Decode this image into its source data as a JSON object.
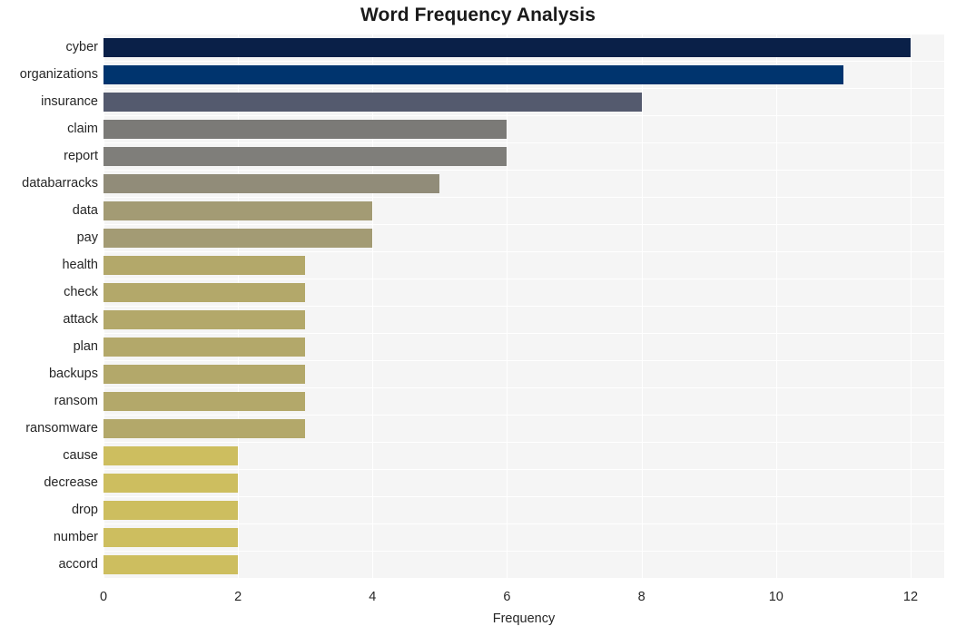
{
  "chart_data": {
    "type": "bar",
    "orientation": "horizontal",
    "title": "Word Frequency Analysis",
    "xlabel": "Frequency",
    "ylabel": "",
    "categories": [
      "cyber",
      "organizations",
      "insurance",
      "claim",
      "report",
      "databarracks",
      "data",
      "pay",
      "health",
      "check",
      "attack",
      "plan",
      "backups",
      "ransom",
      "ransomware",
      "cause",
      "decrease",
      "drop",
      "number",
      "accord"
    ],
    "values": [
      12,
      11,
      8,
      6,
      6,
      5,
      4,
      4,
      3,
      3,
      3,
      3,
      3,
      3,
      3,
      2,
      2,
      2,
      2,
      2
    ],
    "bar_colors": [
      "#0a2048",
      "#00346e",
      "#545a6e",
      "#7b7a77",
      "#7f7e7a",
      "#918c79",
      "#a39b74",
      "#a39b74",
      "#b3a86a",
      "#b3a86a",
      "#b3a86a",
      "#b3a86a",
      "#b3a86a",
      "#b3a86a",
      "#b3a86a",
      "#cdbe5f",
      "#cdbe5f",
      "#cdbe5f",
      "#cdbe5f",
      "#cdbe5f"
    ],
    "xlim": [
      0,
      12.5
    ],
    "xticks": [
      0,
      2,
      4,
      6,
      8,
      10,
      12
    ],
    "xticklabels": [
      "0",
      "2",
      "4",
      "6",
      "8",
      "10",
      "12"
    ],
    "grid": true,
    "grid_color": "#ffffff",
    "plot_background": "#f5f5f5",
    "figure_background": "#ffffff",
    "legend": null
  }
}
